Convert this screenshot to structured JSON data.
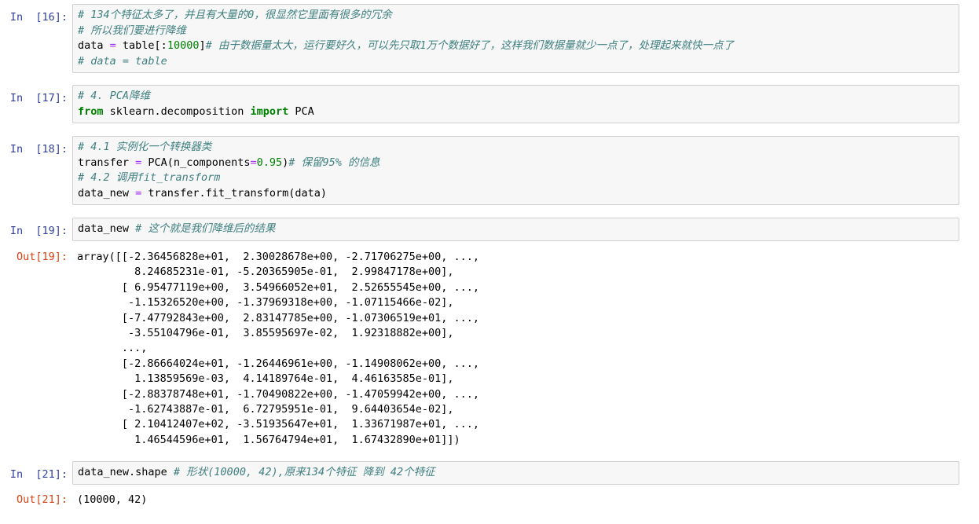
{
  "cells": [
    {
      "prompt": "In  [16]:",
      "lines": [
        [
          {
            "t": "cm",
            "v": "# 134个特征太多了，并且有大量的0，很显然它里面有很多的冗余"
          }
        ],
        [
          {
            "t": "cm",
            "v": "# 所以我们要进行降维"
          }
        ],
        [
          {
            "t": "",
            "v": "data "
          },
          {
            "t": "op",
            "v": "="
          },
          {
            "t": "",
            "v": " table[:"
          },
          {
            "t": "num",
            "v": "10000"
          },
          {
            "t": "",
            "v": "]"
          },
          {
            "t": "cm",
            "v": "# 由于数据量太大，运行要好久，可以先只取1万个数据好了，这样我们数据量就少一点了，处理起来就快一点了"
          }
        ],
        [
          {
            "t": "cm",
            "v": "# data = table"
          }
        ]
      ]
    },
    {
      "prompt": "In  [17]:",
      "lines": [
        [
          {
            "t": "cm",
            "v": "# 4. PCA降维"
          }
        ],
        [
          {
            "t": "kw",
            "v": "from"
          },
          {
            "t": "",
            "v": " sklearn.decomposition "
          },
          {
            "t": "kw",
            "v": "import"
          },
          {
            "t": "",
            "v": " PCA"
          }
        ]
      ]
    },
    {
      "prompt": "In  [18]:",
      "lines": [
        [
          {
            "t": "cm",
            "v": "# 4.1 实例化一个转换器类"
          }
        ],
        [
          {
            "t": "",
            "v": "transfer "
          },
          {
            "t": "op",
            "v": "="
          },
          {
            "t": "",
            "v": " PCA(n_components"
          },
          {
            "t": "op",
            "v": "="
          },
          {
            "t": "num",
            "v": "0.95"
          },
          {
            "t": "",
            "v": ")"
          },
          {
            "t": "cm",
            "v": "# 保留95% 的信息"
          }
        ],
        [
          {
            "t": "cm",
            "v": "# 4.2 调用fit_transform"
          }
        ],
        [
          {
            "t": "",
            "v": "data_new "
          },
          {
            "t": "op",
            "v": "="
          },
          {
            "t": "",
            "v": " transfer.fit_transform(data)"
          }
        ]
      ]
    },
    {
      "prompt": "In  [19]:",
      "lines": [
        [
          {
            "t": "",
            "v": "data_new "
          },
          {
            "t": "cm",
            "v": "# 这个就是我们降维后的结果"
          }
        ]
      ]
    },
    {
      "prompt": "In  [21]:",
      "lines": [
        [
          {
            "t": "",
            "v": "data_new.shape "
          },
          {
            "t": "cm",
            "v": "# 形状(10000, 42),原来134个特征 降到 42个特征"
          }
        ]
      ]
    }
  ],
  "outputs": [
    {
      "prompt": "Out[19]:",
      "lines": [
        "array([[-2.36456828e+01,  2.30028678e+00, -2.71706275e+00, ...,",
        "         8.24685231e-01, -5.20365905e-01,  2.99847178e+00],",
        "       [ 6.95477119e+00,  3.54966052e+01,  2.52655545e+00, ...,",
        "        -1.15326520e+00, -1.37969318e+00, -1.07115466e-02],",
        "       [-7.47792843e+00,  2.83147785e+00, -1.07306519e+01, ...,",
        "        -3.55104796e-01,  3.85595697e-02,  1.92318882e+00],",
        "       ...,",
        "       [-2.86664024e+01, -1.26446961e+00, -1.14908062e+00, ...,",
        "         1.13859569e-03,  4.14189764e-01,  4.46163585e-01],",
        "       [-2.88378748e+01, -1.70490822e+00, -1.47059942e+00, ...,",
        "        -1.62743887e-01,  6.72795951e-01,  9.64403654e-02],",
        "       [ 2.10412407e+02, -3.51935647e+01,  1.33671987e+01, ...,",
        "         1.46544596e+01,  1.56764794e+01,  1.67432890e+01]])"
      ]
    },
    {
      "prompt": "Out[21]:",
      "lines": [
        "(10000, 42)"
      ]
    }
  ]
}
